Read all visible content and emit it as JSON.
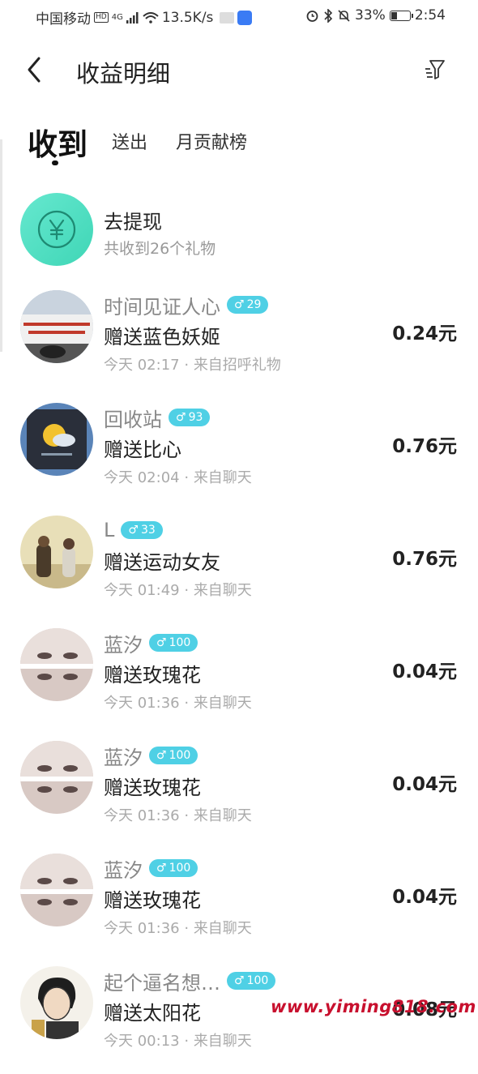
{
  "status_bar": {
    "carrier": "中国移动",
    "hd": "HD",
    "network": "4G",
    "speed": "13.5K/s",
    "battery": "33%",
    "battery_level": 0.33,
    "time": "2:54"
  },
  "header": {
    "title": "收益明细",
    "back_icon": "chevron-left-icon",
    "filter_icon": "filter-icon"
  },
  "tabs": [
    {
      "label": "收到",
      "active": true
    },
    {
      "label": "送出",
      "active": false
    },
    {
      "label": "月贡献榜",
      "active": false
    }
  ],
  "withdraw": {
    "icon": "yen-icon",
    "title": "去提现",
    "subtitle": "共收到26个礼物"
  },
  "records": [
    {
      "name": "时间见证人心",
      "level": "29",
      "gift": "赠送蓝色妖姬",
      "time": "今天 02:17",
      "sep": "·",
      "source": "来自招呼礼物",
      "amount": "0.24元"
    },
    {
      "name": "回收站",
      "level": "93",
      "gift": "赠送比心",
      "time": "今天 02:04",
      "sep": "·",
      "source": "来自聊天",
      "amount": "0.76元"
    },
    {
      "name": "L",
      "level": "33",
      "gift": "赠送运动女友",
      "time": "今天 01:49",
      "sep": "·",
      "source": "来自聊天",
      "amount": "0.76元"
    },
    {
      "name": "蓝汐",
      "level": "100",
      "gift": "赠送玫瑰花",
      "time": "今天 01:36",
      "sep": "·",
      "source": "来自聊天",
      "amount": "0.04元"
    },
    {
      "name": "蓝汐",
      "level": "100",
      "gift": "赠送玫瑰花",
      "time": "今天 01:36",
      "sep": "·",
      "source": "来自聊天",
      "amount": "0.04元"
    },
    {
      "name": "蓝汐",
      "level": "100",
      "gift": "赠送玫瑰花",
      "time": "今天 01:36",
      "sep": "·",
      "source": "来自聊天",
      "amount": "0.04元"
    },
    {
      "name": "起个逼名想…",
      "level": "100",
      "gift": "赠送太阳花",
      "time": "今天 00:13",
      "sep": "·",
      "source": "来自聊天",
      "amount": "0.08元"
    }
  ],
  "gender_symbol": "♂",
  "watermark": "www.yiming818.com",
  "colors": {
    "badge": "#4fd0e5",
    "withdraw": "#4fdcbf",
    "watermark": "#c8102e"
  }
}
